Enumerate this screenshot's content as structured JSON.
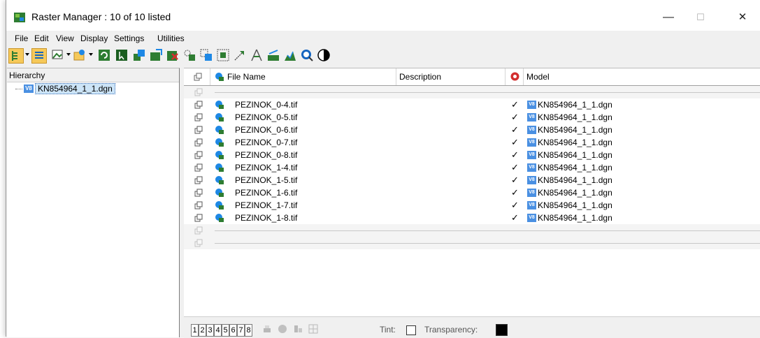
{
  "window": {
    "title": "Raster Manager : 10 of 10 listed",
    "minimize_glyph": "—",
    "maximize_glyph": "☐",
    "close_glyph": "✕"
  },
  "menu": {
    "items": [
      {
        "label": "File"
      },
      {
        "label": "Edit"
      },
      {
        "label": "View"
      },
      {
        "label": "Display"
      },
      {
        "label": "Settings"
      },
      {
        "label": "Utilities"
      }
    ]
  },
  "toolbar": {
    "icons": [
      "hierarchy-toggle-icon",
      "list-view-icon",
      "attach-raster-icon",
      "open-raster-icon",
      "reload-icon",
      "select-icon",
      "merge-icon",
      "export-icon",
      "detach-icon",
      "transform-icon",
      "clip-icon",
      "fit-icon",
      "move-icon",
      "warp-icon",
      "adjust-icon",
      "histogram-icon",
      "view-icon",
      "contrast-icon"
    ]
  },
  "hierarchy": {
    "header": "Hierarchy",
    "items": [
      {
        "label": "KN854964_1_1.dgn",
        "icon": "V8"
      }
    ]
  },
  "grid": {
    "columns": {
      "file_name": "File Name",
      "description": "Description",
      "model": "Model"
    },
    "rows": [
      {
        "file": "PEZINOK_0-4.tif",
        "check": "✓",
        "model": "KN854964_1_1.dgn"
      },
      {
        "file": "PEZINOK_0-5.tif",
        "check": "✓",
        "model": "KN854964_1_1.dgn"
      },
      {
        "file": "PEZINOK_0-6.tif",
        "check": "✓",
        "model": "KN854964_1_1.dgn"
      },
      {
        "file": "PEZINOK_0-7.tif",
        "check": "✓",
        "model": "KN854964_1_1.dgn"
      },
      {
        "file": "PEZINOK_0-8.tif",
        "check": "✓",
        "model": "KN854964_1_1.dgn"
      },
      {
        "file": "PEZINOK_1-4.tif",
        "check": "✓",
        "model": "KN854964_1_1.dgn"
      },
      {
        "file": "PEZINOK_1-5.tif",
        "check": "✓",
        "model": "KN854964_1_1.dgn"
      },
      {
        "file": "PEZINOK_1-6.tif",
        "check": "✓",
        "model": "KN854964_1_1.dgn"
      },
      {
        "file": "PEZINOK_1-7.tif",
        "check": "✓",
        "model": "KN854964_1_1.dgn"
      },
      {
        "file": "PEZINOK_1-8.tif",
        "check": "✓",
        "model": "KN854964_1_1.dgn"
      }
    ],
    "model_icon_text": "V8"
  },
  "bottom": {
    "views": [
      "1",
      "2",
      "3",
      "4",
      "5",
      "6",
      "7",
      "8"
    ],
    "tint_label": "Tint:",
    "transparency_label": "Transparency:"
  },
  "colors": {
    "accent": "#4a90e2",
    "selection": "#cce4f7",
    "transparency_swatch": "#000000"
  }
}
